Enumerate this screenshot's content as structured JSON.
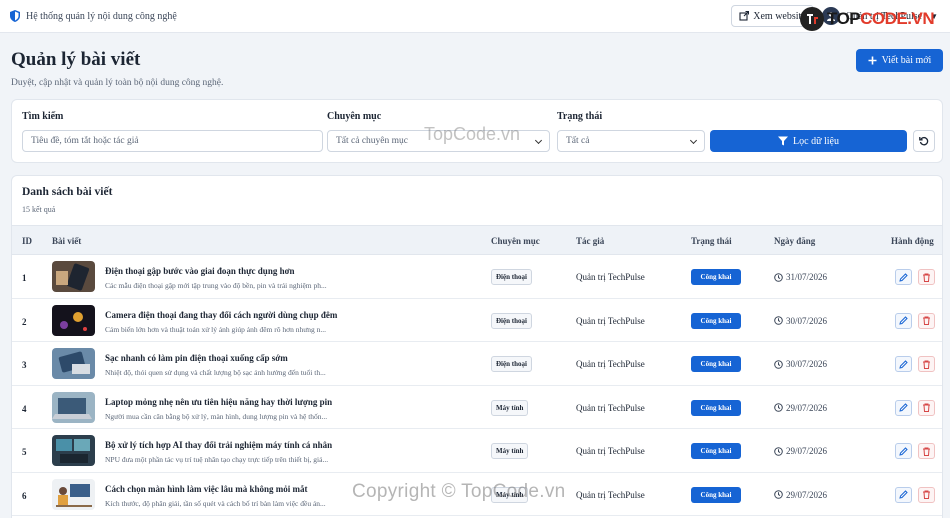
{
  "topbar": {
    "brand_icon": "shield-icon",
    "brand_text": "Hệ thống quản lý nội dung công nghệ",
    "view_site_label": "Xem website",
    "user_name": "Quản trị TechPulse"
  },
  "watermark": {
    "logo_text_dark": "TOP",
    "logo_text_red": "CODE.VN",
    "center": "TopCode.vn",
    "bottom": "Copyright © TopCode.vn"
  },
  "header": {
    "title": "Quản lý bài viết",
    "subtitle": "Duyệt, cập nhật và quản lý toàn bộ nội dung công nghệ.",
    "new_button": "Viết bài mới"
  },
  "filters": {
    "search_label": "Tìm kiếm",
    "search_placeholder": "Tiêu đề, tóm tắt hoặc tác giả",
    "category_label": "Chuyên mục",
    "category_value": "Tất cả chuyên mục",
    "status_label": "Trạng thái",
    "status_value": "Tất cả",
    "filter_button": "Lọc dữ liệu"
  },
  "list": {
    "title": "Danh sách bài viết",
    "count": "15 kết quả",
    "columns": [
      "ID",
      "Bài viết",
      "Chuyên mục",
      "Tác giả",
      "Trạng thái",
      "Ngày đăng",
      "Hành động"
    ],
    "rows": [
      {
        "id": "1",
        "title": "Điện thoại gập bước vào giai đoạn thực dụng hơn",
        "excerpt": "Các mẫu điện thoại gập mới tập trung vào độ bền, pin và trải nghiệm ph...",
        "category": "Điện thoại",
        "author": "Quản trị TechPulse",
        "status": "Công khai",
        "date": "31/07/2026"
      },
      {
        "id": "2",
        "title": "Camera điện thoại đang thay đổi cách người dùng chụp đêm",
        "excerpt": "Cảm biến lớn hơn và thuật toán xử lý ảnh giúp ảnh đêm rõ hơn nhưng n...",
        "category": "Điện thoại",
        "author": "Quản trị TechPulse",
        "status": "Công khai",
        "date": "30/07/2026"
      },
      {
        "id": "3",
        "title": "Sạc nhanh có làm pin điện thoại xuống cấp sớm",
        "excerpt": "Nhiệt độ, thói quen sử dụng và chất lượng bộ sạc ảnh hưởng đến tuổi th...",
        "category": "Điện thoại",
        "author": "Quản trị TechPulse",
        "status": "Công khai",
        "date": "30/07/2026"
      },
      {
        "id": "4",
        "title": "Laptop mỏng nhẹ nên ưu tiên hiệu năng hay thời lượng pin",
        "excerpt": "Người mua cần cân bằng bộ xử lý, màn hình, dung lượng pin và hệ thốn...",
        "category": "Máy tính",
        "author": "Quản trị TechPulse",
        "status": "Công khai",
        "date": "29/07/2026"
      },
      {
        "id": "5",
        "title": "Bộ xử lý tích hợp AI thay đổi trải nghiệm máy tính cá nhân",
        "excerpt": "NPU đưa một phần tác vụ trí tuệ nhân tạo chạy trực tiếp trên thiết bị, giả...",
        "category": "Máy tính",
        "author": "Quản trị TechPulse",
        "status": "Công khai",
        "date": "29/07/2026"
      },
      {
        "id": "6",
        "title": "Cách chọn màn hình làm việc lâu mà không mỏi mắt",
        "excerpt": "Kích thước, độ phân giải, tần số quét và cách bố trí bàn làm việc đều ản...",
        "category": "Máy tính",
        "author": "Quản trị TechPulse",
        "status": "Công khai",
        "date": "29/07/2026"
      }
    ]
  },
  "colors": {
    "primary": "#1664d4",
    "danger": "#d64545"
  }
}
